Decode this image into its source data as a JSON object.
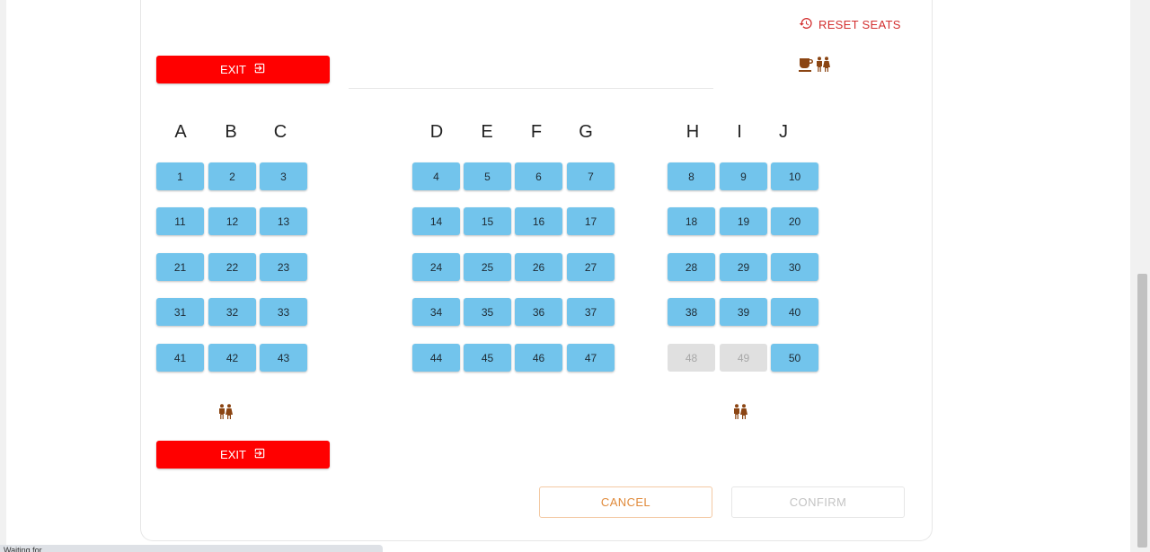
{
  "header": {
    "reset_label": "RESET SEATS",
    "reset_icon": "history-icon"
  },
  "exits": {
    "top_label": "EXIT",
    "bottom_label": "EXIT",
    "icon": "exit-to-app-icon",
    "color": "#ff0000"
  },
  "amenities": {
    "icons": [
      "coffee-icon",
      "restroom-icon"
    ],
    "color": "#8b4513"
  },
  "columns": {
    "left": [
      "A",
      "B",
      "C"
    ],
    "middle": [
      "D",
      "E",
      "F",
      "G"
    ],
    "right": [
      "H",
      "I",
      "J"
    ]
  },
  "seats": [
    {
      "number": "1",
      "status": "available"
    },
    {
      "number": "2",
      "status": "available"
    },
    {
      "number": "3",
      "status": "available"
    },
    {
      "number": "4",
      "status": "available"
    },
    {
      "number": "5",
      "status": "available"
    },
    {
      "number": "6",
      "status": "available"
    },
    {
      "number": "7",
      "status": "available"
    },
    {
      "number": "8",
      "status": "available"
    },
    {
      "number": "9",
      "status": "available"
    },
    {
      "number": "10",
      "status": "available"
    },
    {
      "number": "11",
      "status": "available"
    },
    {
      "number": "12",
      "status": "available"
    },
    {
      "number": "13",
      "status": "available"
    },
    {
      "number": "14",
      "status": "available"
    },
    {
      "number": "15",
      "status": "available"
    },
    {
      "number": "16",
      "status": "available"
    },
    {
      "number": "17",
      "status": "available"
    },
    {
      "number": "18",
      "status": "available"
    },
    {
      "number": "19",
      "status": "available"
    },
    {
      "number": "20",
      "status": "available"
    },
    {
      "number": "21",
      "status": "available"
    },
    {
      "number": "22",
      "status": "available"
    },
    {
      "number": "23",
      "status": "available"
    },
    {
      "number": "24",
      "status": "available"
    },
    {
      "number": "25",
      "status": "available"
    },
    {
      "number": "26",
      "status": "available"
    },
    {
      "number": "27",
      "status": "available"
    },
    {
      "number": "28",
      "status": "available"
    },
    {
      "number": "29",
      "status": "available"
    },
    {
      "number": "30",
      "status": "available"
    },
    {
      "number": "31",
      "status": "available"
    },
    {
      "number": "32",
      "status": "available"
    },
    {
      "number": "33",
      "status": "available"
    },
    {
      "number": "34",
      "status": "available"
    },
    {
      "number": "35",
      "status": "available"
    },
    {
      "number": "36",
      "status": "available"
    },
    {
      "number": "37",
      "status": "available"
    },
    {
      "number": "38",
      "status": "available"
    },
    {
      "number": "39",
      "status": "available"
    },
    {
      "number": "40",
      "status": "available"
    },
    {
      "number": "41",
      "status": "available"
    },
    {
      "number": "42",
      "status": "available"
    },
    {
      "number": "43",
      "status": "available"
    },
    {
      "number": "44",
      "status": "available"
    },
    {
      "number": "45",
      "status": "available"
    },
    {
      "number": "46",
      "status": "available"
    },
    {
      "number": "47",
      "status": "available"
    },
    {
      "number": "48",
      "status": "unavailable"
    },
    {
      "number": "49",
      "status": "unavailable"
    },
    {
      "number": "50",
      "status": "available"
    }
  ],
  "seat_colors": {
    "available": "#72c4ec",
    "unavailable": "#e0e0e0"
  },
  "restrooms": [
    "restroom-icon",
    "restroom-icon"
  ],
  "actions": {
    "cancel_label": "CANCEL",
    "confirm_label": "CONFIRM"
  },
  "statusbar": {
    "text": "Waiting for ..."
  }
}
